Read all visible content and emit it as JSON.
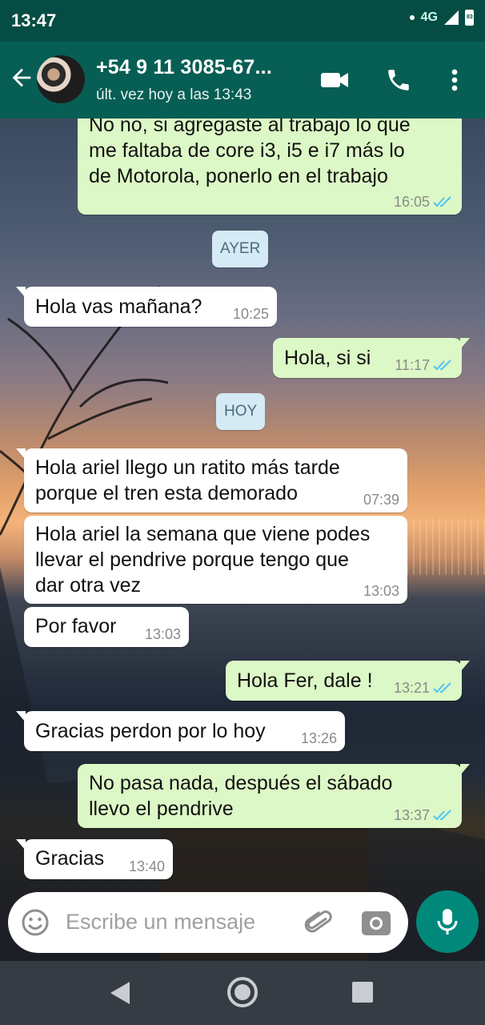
{
  "status_bar": {
    "time": "13:47",
    "network": "4G",
    "battery": "83"
  },
  "header": {
    "contact_name": "+54 9 11 3085-67...",
    "last_seen": "últ. vez hoy a las 13:43",
    "icons": [
      "back-arrow-icon",
      "video-call-icon",
      "phone-icon",
      "more-vert-icon"
    ]
  },
  "messages": [
    {
      "dir": "out",
      "text": "No no, si agregaste al trabajo lo que\nme faltaba de core i3, i5 e i7 más lo\nde Motorola, ponerlo en el trabajo",
      "time": "16:05",
      "read": true
    },
    {
      "dir": "chip",
      "text": "AYER"
    },
    {
      "dir": "in",
      "text": "Hola vas mañana?",
      "time": "10:25"
    },
    {
      "dir": "out",
      "text": "Hola, si si",
      "time": "11:17",
      "read": true
    },
    {
      "dir": "chip",
      "text": "HOY"
    },
    {
      "dir": "in",
      "text": "Hola ariel llego un ratito más tarde\nporque el tren esta demorado",
      "time": "07:39"
    },
    {
      "dir": "in",
      "text": "Hola ariel la semana que viene podes\nllevar el pendrive porque tengo que\ndar otra vez",
      "time": "13:03"
    },
    {
      "dir": "in",
      "text": "Por favor",
      "time": "13:03"
    },
    {
      "dir": "out",
      "text": "Hola Fer, dale !",
      "time": "13:21",
      "read": true
    },
    {
      "dir": "in",
      "text": "Gracias perdon por lo hoy",
      "time": "13:26"
    },
    {
      "dir": "out",
      "text": "No pasa nada, después el sábado\nllevo el pendrive",
      "time": "13:37",
      "read": true
    },
    {
      "dir": "in",
      "text": "Gracias",
      "time": "13:40"
    }
  ],
  "composer": {
    "placeholder": "Escribe un mensaje"
  },
  "colors": {
    "header": "#075e54",
    "status_bar": "#054d44",
    "outgoing": "#dcf8c6",
    "incoming": "#ffffff",
    "accent": "#00897b",
    "read_ticks": "#4fc3f7"
  }
}
